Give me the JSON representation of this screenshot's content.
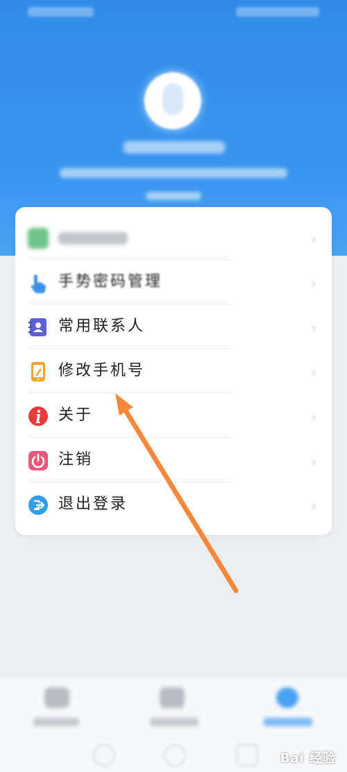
{
  "menu": {
    "items": [
      {
        "label": "手势密码管理",
        "icon": "hand-pointer-icon"
      },
      {
        "label": "常用联系人",
        "icon": "contact-book-icon"
      },
      {
        "label": "修改手机号",
        "icon": "phone-edit-icon"
      },
      {
        "label": "关于",
        "icon": "info-icon"
      },
      {
        "label": "注销",
        "icon": "power-icon"
      },
      {
        "label": "退出登录",
        "icon": "logout-icon"
      }
    ]
  },
  "annotation": {
    "color": "#f5883a"
  },
  "colors": {
    "header_blue": "#3a97f0",
    "accent_orange": "#f5883a"
  },
  "watermark": {
    "text": "Bai 经验"
  }
}
